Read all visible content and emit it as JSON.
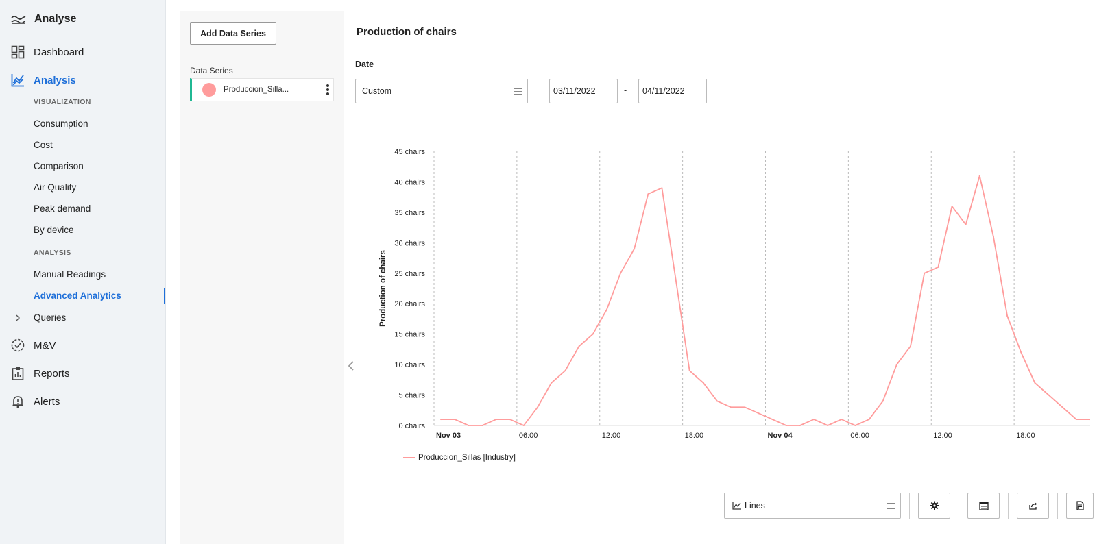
{
  "app": {
    "title": "Analyse"
  },
  "nav": {
    "dashboard": "Dashboard",
    "analysis": "Analysis",
    "visualization_header": "VISUALIZATION",
    "consumption": "Consumption",
    "cost": "Cost",
    "comparison": "Comparison",
    "air_quality": "Air Quality",
    "peak_demand": "Peak demand",
    "by_device": "By device",
    "analysis_header": "ANALYSIS",
    "manual_readings": "Manual Readings",
    "advanced_analytics": "Advanced Analytics",
    "queries": "Queries",
    "mv": "M&V",
    "reports": "Reports",
    "alerts": "Alerts"
  },
  "series_panel": {
    "add_button": "Add Data Series",
    "label": "Data Series",
    "items": [
      {
        "name": "Produccion_Silla...",
        "color": "#ff9c9c"
      }
    ]
  },
  "main": {
    "title": "Production of chairs",
    "date_label": "Date",
    "date_mode": "Custom",
    "date_from": "03/11/2022",
    "date_to": "04/11/2022",
    "date_sep": "-"
  },
  "chart_data": {
    "type": "line",
    "ylabel": "Production of chairs",
    "ylim": [
      0,
      45
    ],
    "y_ticks": [
      "0 chairs",
      "5 chairs",
      "10 chairs",
      "15 chairs",
      "20 chairs",
      "25 chairs",
      "30 chairs",
      "35 chairs",
      "40 chairs",
      "45 chairs"
    ],
    "x_ticks": [
      {
        "label": "Nov 03",
        "hour": 0,
        "bold": true
      },
      {
        "label": "06:00",
        "hour": 6,
        "bold": false
      },
      {
        "label": "12:00",
        "hour": 12,
        "bold": false
      },
      {
        "label": "18:00",
        "hour": 18,
        "bold": false
      },
      {
        "label": "Nov 04",
        "hour": 24,
        "bold": true
      },
      {
        "label": "06:00",
        "hour": 30,
        "bold": false
      },
      {
        "label": "12:00",
        "hour": 36,
        "bold": false
      },
      {
        "label": "18:00",
        "hour": 42,
        "bold": false
      }
    ],
    "xlim_hours": [
      0,
      48
    ],
    "grid": "vertical dashed",
    "legend_position": "bottom-left",
    "series": [
      {
        "name": "Produccion_Sillas [Industry]",
        "color": "#ff9c9c",
        "x_hours": [
          0.5,
          1.5,
          2.5,
          3.5,
          4.5,
          5.5,
          6.5,
          7.5,
          8.5,
          9.5,
          10.5,
          11.5,
          12.5,
          13.5,
          14.5,
          15.5,
          16.5,
          17.5,
          18.5,
          19.5,
          20.5,
          21.5,
          22.5,
          23.5,
          24.5,
          25.5,
          26.5,
          27.5,
          28.5,
          29.5,
          30.5,
          31.5,
          32.5,
          33.5,
          34.5,
          35.5,
          36.5,
          37.5,
          38.5,
          39.5,
          40.5,
          41.5,
          42.5,
          43.5,
          44.5,
          45.5,
          46.5,
          47.5
        ],
        "values": [
          1,
          1,
          0,
          0,
          1,
          1,
          0,
          3,
          7,
          9,
          13,
          15,
          19,
          25,
          29,
          38,
          39,
          24,
          9,
          7,
          4,
          3,
          3,
          2,
          1,
          0,
          0,
          1,
          0,
          1,
          0,
          1,
          4,
          10,
          13,
          25,
          26,
          36,
          33,
          41,
          31,
          18,
          12,
          7,
          5,
          3,
          1,
          1
        ]
      }
    ]
  },
  "toolbar": {
    "chart_type": "Lines"
  }
}
